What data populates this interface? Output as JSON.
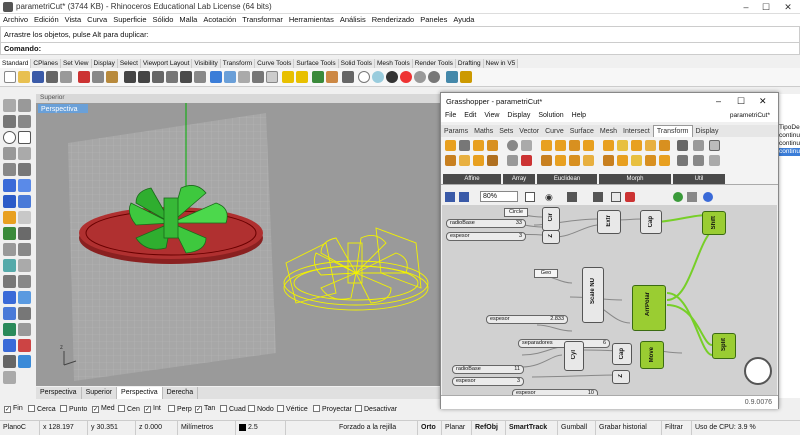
{
  "rhino": {
    "title": "parametriCut* (3744 KB) - Rhinoceros Educational Lab License (64 bits)",
    "menu": [
      "Archivo",
      "Edición",
      "Vista",
      "Curva",
      "Superficie",
      "Sólido",
      "Malla",
      "Acotación",
      "Transformar",
      "Herramientas",
      "Análisis",
      "Renderizado",
      "Paneles",
      "Ayuda"
    ],
    "command_history": "Arrastre los objetos, pulse Alt para duplicar:",
    "command_prompt": "Comando:",
    "toolbar_tabs": [
      "Standard",
      "CPlanes",
      "Set View",
      "Display",
      "Select",
      "Viewport Layout",
      "Visibility",
      "Transform",
      "Curve Tools",
      "Surface Tools",
      "Solid Tools",
      "Mesh Tools",
      "Render Tools",
      "Drafting",
      "New in V5"
    ],
    "viewport_header": "Superior",
    "viewport_title": "Perspectiva",
    "viewport_tabs": [
      "Perspectiva",
      "Superior",
      "Perspectiva",
      "Derecha"
    ],
    "viewport_active_tab": 2,
    "osnaps": [
      {
        "label": "Fin",
        "checked": true
      },
      {
        "label": "Cerca",
        "checked": false
      },
      {
        "label": "Punto",
        "checked": false
      },
      {
        "label": "Med",
        "checked": true
      },
      {
        "label": "Cen",
        "checked": false
      },
      {
        "label": "Int",
        "checked": true
      },
      {
        "label": "Perp",
        "checked": false
      },
      {
        "label": "Tan",
        "checked": true
      },
      {
        "label": "Cuad",
        "checked": false
      },
      {
        "label": "Nodo",
        "checked": false
      },
      {
        "label": "Vértice",
        "checked": false
      },
      {
        "label": "Proyectar",
        "checked": false
      },
      {
        "label": "Desactivar",
        "checked": false
      }
    ],
    "status": {
      "plane": "PlanoC",
      "x": "x 128.197",
      "y": "y 30.351",
      "z": "z 0.000",
      "units": "Milímetros",
      "layer": "2.5",
      "grid_snap": "Forzado a la rejilla",
      "ortho": "Orto",
      "planar": "Planar",
      "osnap": "RefObj",
      "smarttrack": "SmartTrack",
      "gumball": "Gumball",
      "history": "Grabar historial",
      "filter": "Filtrar",
      "cpu": "Uso de CPU: 3.9 %"
    },
    "right_panel": [
      "TipoDe",
      "continua",
      "continua",
      "continua"
    ]
  },
  "gh": {
    "title": "Grasshopper - parametriCut*",
    "menu": [
      "File",
      "Edit",
      "View",
      "Display",
      "Solution",
      "Help"
    ],
    "doc_name": "parametriCut*",
    "tabs": [
      "Params",
      "Maths",
      "Sets",
      "Vector",
      "Curve",
      "Surface",
      "Mesh",
      "Intersect",
      "Transform",
      "Display"
    ],
    "active_tab": "Transform",
    "groups": [
      "Affine",
      "Array",
      "Euclidean",
      "Morph",
      "Util"
    ],
    "zoom": "80%",
    "version": "0.9.0076",
    "components": {
      "circle": "Circle",
      "radio_slider": {
        "label": "radioBase",
        "value": "33"
      },
      "espesor_slider": {
        "label": "espesor",
        "value": "3"
      },
      "cir": "Cir",
      "z1": "Z",
      "extr": "Extr",
      "cap": "Cap",
      "shift": "Shift",
      "geo": "Geo",
      "scale_nu": "Scale NU",
      "espesor2": {
        "label": "espesor",
        "value": "2.833"
      },
      "separadores": {
        "label": "separadores",
        "value": "6"
      },
      "arr_polar": "ArrPolar",
      "radio2": {
        "label": "radioBase",
        "value": "11"
      },
      "espesor3": {
        "label": "espesor",
        "value": "3"
      },
      "espesor4": {
        "label": "espesor",
        "value": "10"
      },
      "cyl": "Cyl",
      "cap2": "Cap",
      "move": "Move",
      "split": "Split",
      "z2": "Z"
    }
  }
}
